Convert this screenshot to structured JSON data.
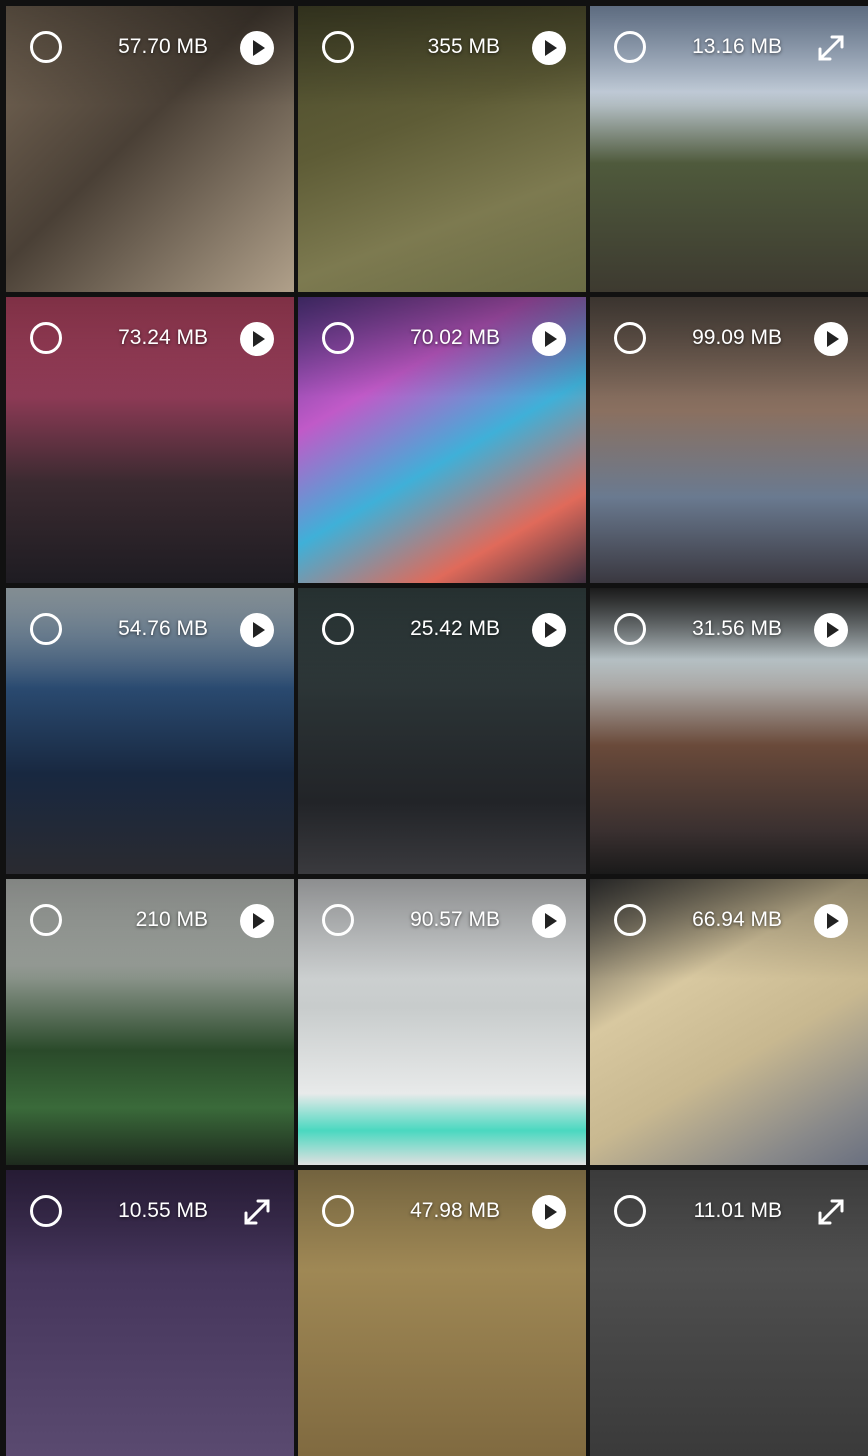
{
  "gallery": {
    "items": [
      {
        "size": "57.70 MB",
        "type": "video",
        "bg": "linear-gradient(135deg,#7a6a58 0%,#4a4036 45%,#b0a08a 100%)"
      },
      {
        "size": "355 MB",
        "type": "video",
        "bg": "linear-gradient(160deg,#4a4a2c 0%,#5e5c36 40%,#7d7a50 70%,#6a6c45 100%)"
      },
      {
        "size": "13.16 MB",
        "type": "photo",
        "bg": "linear-gradient(180deg,#8fa5c4 0%,#c8d3e0 30%,#4f5a3c 55%,#3d3a30 100%)"
      },
      {
        "size": "73.24 MB",
        "type": "video",
        "bg": "linear-gradient(180deg,#c24a6a 0%,#8c3a55 35%,#3a2a30 65%,#1e1c22 100%)"
      },
      {
        "size": "70.02 MB",
        "type": "video",
        "bg": "linear-gradient(150deg,#5a3a90 0%,#c05ac8 30%,#3fb0d8 55%,#e06a5a 80%,#403040 100%)"
      },
      {
        "size": "99.09 MB",
        "type": "video",
        "bg": "linear-gradient(180deg,#5a5048 0%,#8a7060 40%,#6a7a90 70%,#3a3840 100%)"
      },
      {
        "size": "54.76 MB",
        "type": "video",
        "bg": "linear-gradient(180deg,#c8d8e0 0%,#2a4a70 35%,#182840 65%,#2a2a30 100%)"
      },
      {
        "size": "25.42 MB",
        "type": "video",
        "bg": "linear-gradient(180deg,#3a4a4a 0%,#2a3234 40%,#222428 75%,#3a3a3e 100%)"
      },
      {
        "size": "31.56 MB",
        "type": "video",
        "bg": "linear-gradient(180deg,#2a2a2a 0%,#c8d4d8 25%,#6a4a3a 55%,#3a3030 85%,#1a1a1a 100%)"
      },
      {
        "size": "210 MB",
        "type": "video",
        "bg": "linear-gradient(180deg,#c8ccc8 0%,#9aa09a 30%,#2a4a2a 60%,#3a6a3a 80%,#1e2a1e 100%)"
      },
      {
        "size": "90.57 MB",
        "type": "video",
        "bg": "linear-gradient(180deg,#d8dadc 0%,#c8cccc 45%,#e8eaea 75%,#4ad8c0 88%,#e0e0e0 100%)"
      },
      {
        "size": "66.94 MB",
        "type": "video",
        "bg": "linear-gradient(150deg,#3a3a3a 0%,#d8c8a0 35%,#c8b890 60%,#8a8a8a 85%,#6a7080 100%)"
      },
      {
        "size": "10.55 MB",
        "type": "photo",
        "bg": "linear-gradient(180deg,#3a2a50 0%,#5a4a70 100%)"
      },
      {
        "size": "47.98 MB",
        "type": "video",
        "bg": "linear-gradient(180deg,#b09860 0%,#806a40 100%)"
      },
      {
        "size": "11.01 MB",
        "type": "photo",
        "bg": "linear-gradient(180deg,#5a5a5a 0%,#3a3a3a 100%)"
      }
    ]
  }
}
